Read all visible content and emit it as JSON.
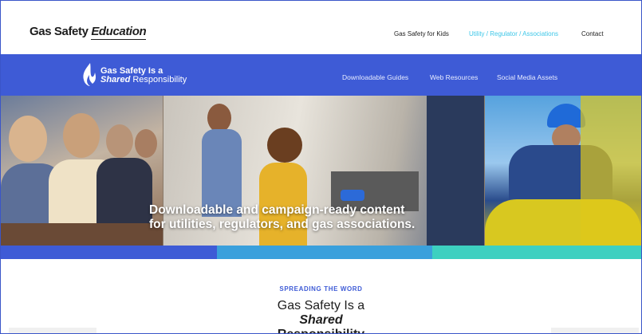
{
  "brand": {
    "name_part1": "Gas Safety ",
    "name_part2": "Education"
  },
  "top_nav": {
    "kids": "Gas Safety for Kids",
    "utility": "Utility / Regulator / Associations",
    "contact": "Contact"
  },
  "logo": {
    "line1": "Gas Safety Is a",
    "line2_italic": "Shared",
    "line2_rest": " Responsibility"
  },
  "blue_nav": {
    "guides": "Downloadable Guides",
    "web": "Web Resources",
    "social": "Social Media Assets"
  },
  "hero": {
    "line1": "Downloadable and campaign-ready content",
    "line2": "for utilities, regulators, and gas associations."
  },
  "section": {
    "kicker": "SPREADING THE WORD",
    "heading_line1": "Gas Safety Is a",
    "heading_line2_italic": "Shared",
    "heading_line2_rest": " Responsibility"
  },
  "colors": {
    "brand_blue": "#3e5bd6",
    "accent_cyan": "#3ec7e8",
    "strip_mid": "#3aa0dc",
    "strip_teal": "#3dd0c0"
  }
}
